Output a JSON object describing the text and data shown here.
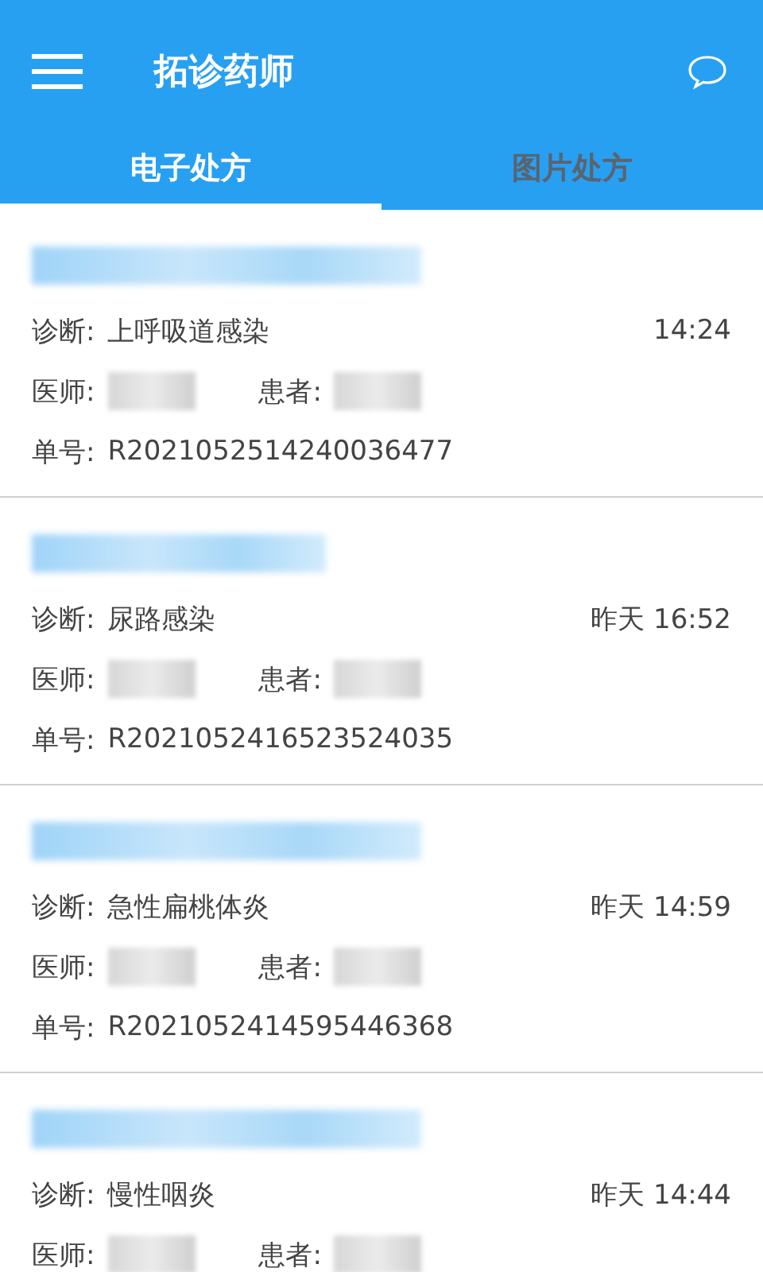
{
  "header": {
    "title": "拓诊药师"
  },
  "tabs": [
    {
      "label": "电子处方",
      "selected": true
    },
    {
      "label": "图片处方",
      "selected": false
    }
  ],
  "prescriptions": [
    {
      "diagnosis_label": "诊断:",
      "diagnosis": "上呼吸道感染",
      "time": "14:24",
      "doctor_label": "医师:",
      "patient_label": "患者:",
      "number_label": "单号:",
      "number": "R2021052514240036477"
    },
    {
      "diagnosis_label": "诊断:",
      "diagnosis": "尿路感染",
      "time": "昨天 16:52",
      "doctor_label": "医师:",
      "patient_label": "患者:",
      "number_label": "单号:",
      "number": "R2021052416523524035"
    },
    {
      "diagnosis_label": "诊断:",
      "diagnosis": "急性扁桃体炎",
      "time": "昨天 14:59",
      "doctor_label": "医师:",
      "patient_label": "患者:",
      "number_label": "单号:",
      "number": "R2021052414595446368"
    },
    {
      "diagnosis_label": "诊断:",
      "diagnosis": "慢性咽炎",
      "time": "昨天 14:44",
      "doctor_label": "医师:",
      "patient_label": "患者:"
    }
  ]
}
